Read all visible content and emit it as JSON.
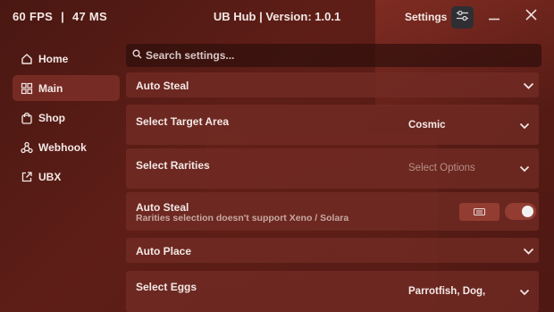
{
  "stats": {
    "fps": "60 FPS",
    "sep": "|",
    "ping": "47 MS"
  },
  "window": {
    "title": "UB Hub | Version: 1.0.1",
    "settings_label": "Settings"
  },
  "sidebar": {
    "items": [
      {
        "label": "Home",
        "icon": "home-icon"
      },
      {
        "label": "Main",
        "icon": "grid-icon",
        "active": true
      },
      {
        "label": "Shop",
        "icon": "shopping-bag-icon"
      },
      {
        "label": "Webhook",
        "icon": "webhook-icon"
      },
      {
        "label": "UBX",
        "icon": "external-link-icon"
      }
    ]
  },
  "search": {
    "placeholder": "Search settings..."
  },
  "rows": {
    "auto_steal_section": {
      "label": "Auto Steal"
    },
    "target_area": {
      "label": "Select Target Area",
      "value": "Cosmic"
    },
    "rarities": {
      "label": "Select Rarities",
      "value": "Select Options"
    },
    "auto_steal_toggle": {
      "label": "Auto Steal",
      "sub": "Rarities selection doesn't support Xeno / Solara",
      "enabled": true
    },
    "auto_place_section": {
      "label": "Auto Place"
    },
    "eggs": {
      "label": "Select Eggs",
      "value": "Parrotfish, Dog,"
    }
  },
  "colors": {
    "accent": "#5e1e17",
    "row_bg": "#73 2c25",
    "toggle_knob": "#f2f2f2"
  }
}
